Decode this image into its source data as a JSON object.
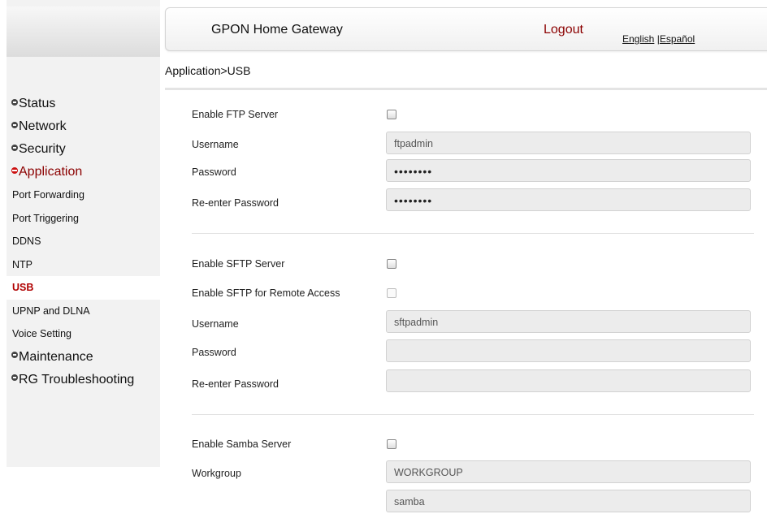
{
  "header": {
    "title": "GPON Home Gateway",
    "logout": "Logout",
    "lang_english": "English",
    "lang_separator": "|",
    "lang_spanish": "Español"
  },
  "breadcrumb": "Application>USB",
  "sidebar": {
    "status": "Status",
    "network": "Network",
    "security": "Security",
    "application": "Application",
    "sub_items": [
      "Port Forwarding",
      "Port Triggering",
      "DDNS",
      "NTP",
      "USB",
      "UPNP and DLNA",
      "Voice Setting"
    ],
    "maintenance": "Maintenance",
    "troubleshooting": "RG Troubleshooting"
  },
  "ftp": {
    "enable_label": "Enable FTP Server",
    "enabled": false,
    "username_label": "Username",
    "username": "ftpadmin",
    "password_label": "Password",
    "password": "••••••••",
    "reenter_label": "Re-enter Password",
    "reenter": "••••••••"
  },
  "sftp": {
    "enable_label": "Enable SFTP Server",
    "enabled": false,
    "remote_label": "Enable SFTP for Remote Access",
    "remote_enabled": false,
    "username_label": "Username",
    "username": "sftpadmin",
    "password_label": "Password",
    "password": "",
    "reenter_label": "Re-enter Password",
    "reenter": ""
  },
  "samba": {
    "enable_label": "Enable Samba Server",
    "enabled": false,
    "workgroup_label": "Workgroup",
    "workgroup": "WORKGROUP",
    "next_value": "samba"
  }
}
